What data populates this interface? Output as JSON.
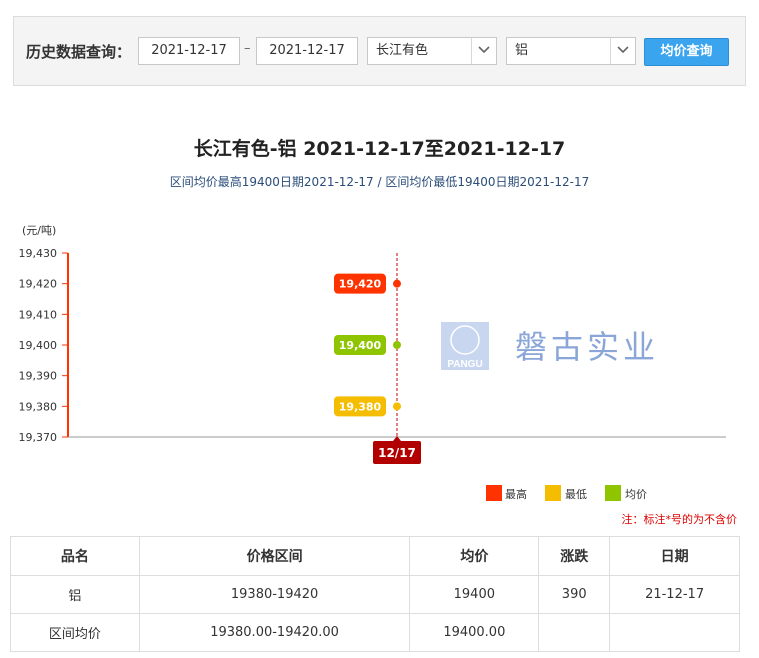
{
  "query": {
    "label": "历史数据查询：",
    "start_date": "2021-12-17",
    "separator": "–",
    "end_date": "2021-12-17",
    "market": "长江有色",
    "metal": "铝",
    "button": "均价查询"
  },
  "title": "长江有色-铝 2021-12-17至2021-12-17",
  "subtitle": "区间均价最高19400日期2021-12-17 / 区间均价最低19400日期2021-12-17",
  "watermark": {
    "text": "磐古实业",
    "logo_text": "PANGU"
  },
  "chart_data": {
    "type": "scatter",
    "yunit": "(元/吨)",
    "ylim": [
      19370,
      19430
    ],
    "yticks": [
      "19,430",
      "19,420",
      "19,410",
      "19,400",
      "19,390",
      "19,380",
      "19,370"
    ],
    "categories": [
      "12/17"
    ],
    "series": [
      {
        "name": "最高",
        "color": "#ff3300",
        "values": [
          19420
        ],
        "label": "19,420"
      },
      {
        "name": "最低",
        "color": "#f5bd00",
        "values": [
          19380
        ],
        "label": "19,380"
      },
      {
        "name": "均价",
        "color": "#8ec500",
        "values": [
          19400
        ],
        "label": "19,400"
      }
    ],
    "legend_position": "bottom-right"
  },
  "note": "注：标注*号的为不含价",
  "table": {
    "headers": [
      "品名",
      "价格区间",
      "均价",
      "涨跌",
      "日期"
    ],
    "rows": [
      [
        "铝",
        "19380-19420",
        "19400",
        "390",
        "21-12-17"
      ],
      [
        "区间均价",
        "19380.00-19420.00",
        "19400.00",
        "",
        ""
      ]
    ]
  },
  "colors": {
    "accent": "#3aa4ee",
    "axis": "#ff3300",
    "date_badge": "#b20000",
    "watermark": "#8aa6d8"
  }
}
